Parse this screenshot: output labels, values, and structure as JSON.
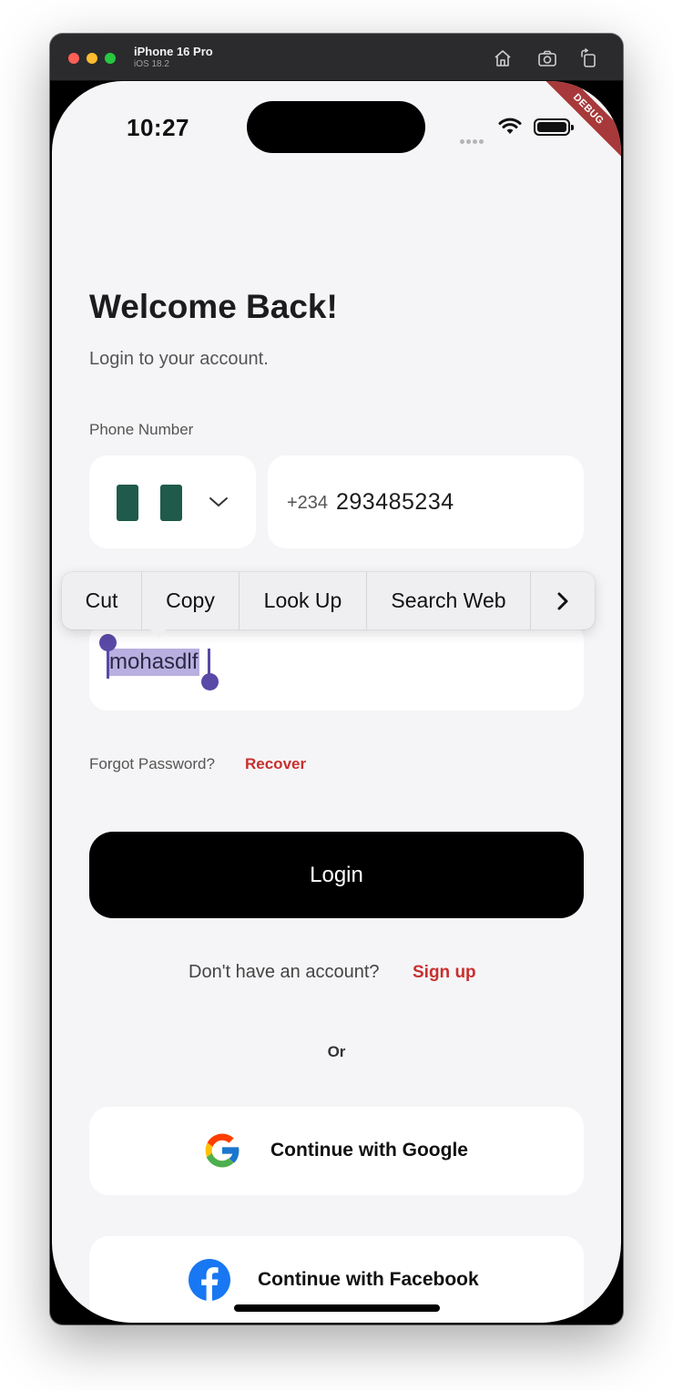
{
  "simulator": {
    "device_name": "iPhone 16 Pro",
    "os_version": "iOS 18.2",
    "toolbar_icons": [
      "home-icon",
      "screenshot-icon",
      "rotate-icon"
    ]
  },
  "status_bar": {
    "time": "10:27",
    "debug_label": "DEBUG"
  },
  "login": {
    "title": "Welcome Back!",
    "subtitle": "Login to your account.",
    "phone_label": "Phone Number",
    "dial_code": "+234",
    "phone_value": "293485234",
    "password_value": "mohasdlf",
    "forgot_text": "Forgot Password?",
    "recover_label": "Recover",
    "login_label": "Login",
    "no_account_text": "Don't have an account?",
    "signup_label": "Sign up",
    "or_text": "Or",
    "google_label": "Continue with Google",
    "facebook_label": "Continue with Facebook"
  },
  "context_menu": {
    "items": [
      "Cut",
      "Copy",
      "Look Up",
      "Search Web"
    ],
    "more_icon": "chevron-right-icon"
  },
  "colors": {
    "accent_red": "#c8302e",
    "selection": "#b9afe0",
    "handle": "#5a49a6",
    "flag_green": "#1f5a4a"
  }
}
